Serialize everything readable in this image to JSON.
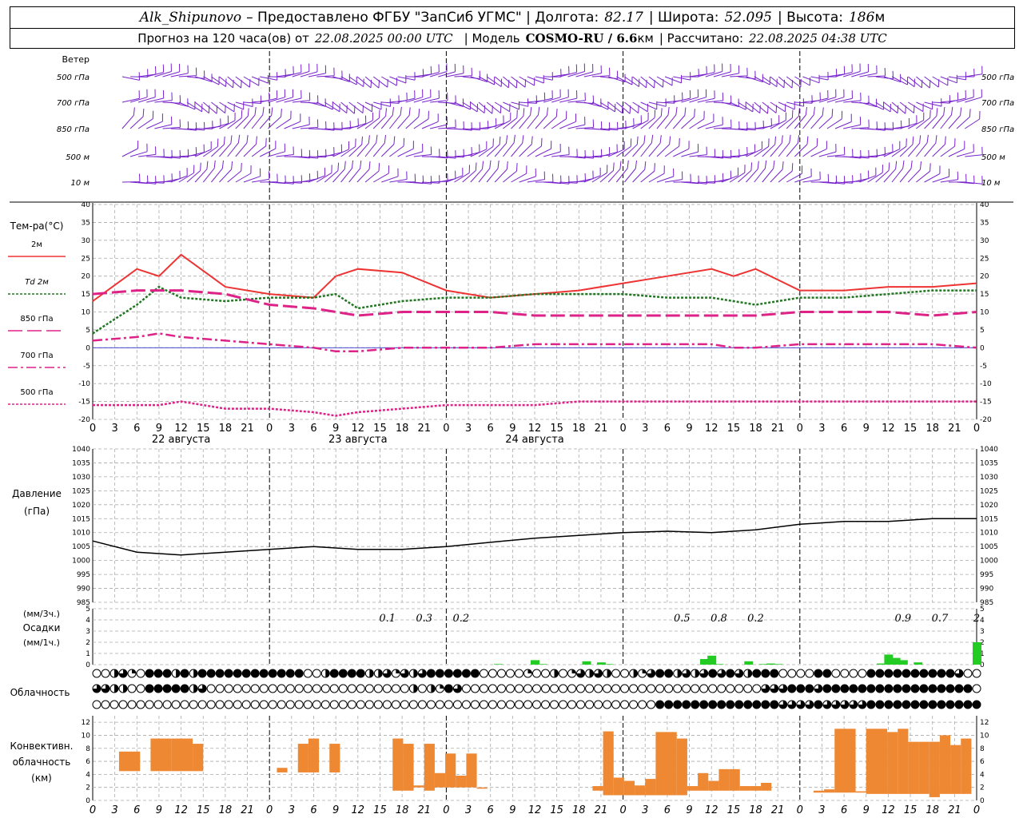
{
  "header": {
    "station": "Alk_Shipunovo",
    "provider": " – Предоставлено ФГБУ \"ЗапСиб УГМС\" | Долгота:",
    "lon": "82.17",
    "lat_label": "| Широта:",
    "lat": "52.095",
    "alt_label": "| Высота:",
    "alt": "186",
    "alt_unit": "м",
    "fc_label": "Прогноз на 120 часа(ов) от",
    "fc_start": "22.08.2025 00:00 UTC",
    "model_label": "| Модель",
    "model": "COSMO-RU / 6.6",
    "model_unit": "км",
    "calc_label": "| Рассчитано:",
    "calc_time": "22.08.2025 04:38 UTC"
  },
  "chart_data": [
    {
      "type": "wind_barbs",
      "title": "Ветер",
      "levels": [
        "500 гПа",
        "700 гПа",
        "850 гПа",
        "500 м",
        "10 м"
      ]
    },
    {
      "type": "line",
      "ylabel": "Тем-ра(°C)",
      "ylim": [
        -20,
        40
      ],
      "yticks": [
        -20,
        -15,
        -10,
        -5,
        0,
        5,
        10,
        15,
        20,
        25,
        30,
        35,
        40
      ],
      "x_hours": [
        0,
        6,
        9,
        12,
        18,
        24,
        30,
        33,
        36,
        42,
        48,
        54,
        60,
        66,
        72,
        78,
        84,
        87,
        90,
        96,
        102,
        108,
        114,
        120
      ],
      "series": [
        {
          "name": "2м",
          "color": "#ee3333",
          "values": [
            13,
            22,
            20,
            26,
            17,
            15,
            14,
            20,
            22,
            21,
            16,
            14,
            15,
            16,
            18,
            20,
            22,
            20,
            22,
            16,
            16,
            17,
            17,
            18
          ]
        },
        {
          "name": "Td 2м",
          "color": "#227722",
          "values": [
            4,
            12,
            17,
            14,
            13,
            14,
            14,
            15,
            11,
            13,
            14,
            14,
            15,
            15,
            15,
            14,
            14,
            13,
            12,
            14,
            14,
            15,
            16,
            16
          ]
        },
        {
          "name": "850 гПа",
          "color": "#dd2288",
          "values": [
            15,
            16,
            16,
            16,
            15,
            12,
            11,
            10,
            9,
            10,
            10,
            10,
            9,
            9,
            9,
            9,
            9,
            9,
            9,
            10,
            10,
            10,
            9,
            10
          ]
        },
        {
          "name": "700 гПа",
          "color": "#dd2288",
          "values": [
            2,
            3,
            4,
            3,
            2,
            1,
            0,
            -1,
            -1,
            0,
            0,
            0,
            1,
            1,
            1,
            1,
            1,
            0,
            0,
            1,
            1,
            1,
            1,
            0
          ]
        },
        {
          "name": "500 гПа",
          "color": "#dd2288",
          "values": [
            -16,
            -16,
            -16,
            -15,
            -17,
            -17,
            -18,
            -19,
            -18,
            -17,
            -16,
            -16,
            -16,
            -15,
            -15,
            -15,
            -15,
            -15,
            -15,
            -15,
            -15,
            -15,
            -15,
            -15
          ]
        }
      ],
      "date_labels": [
        "22 августа",
        "23 августа",
        "24 августа"
      ],
      "xtick_labels": [
        "0",
        "3",
        "6",
        "9",
        "12",
        "15",
        "18",
        "21",
        "0",
        "3",
        "6",
        "9",
        "12",
        "15",
        "18",
        "21",
        "0",
        "3",
        "6",
        "9",
        "12",
        "15",
        "18",
        "21",
        "0",
        "3",
        "6"
      ]
    },
    {
      "type": "line",
      "ylabel": "Давление",
      "yunit": "(гПа)",
      "ylim": [
        985,
        1040
      ],
      "yticks": [
        985,
        990,
        995,
        1000,
        1005,
        1010,
        1015,
        1020,
        1025,
        1030,
        1035,
        1040
      ],
      "x_hours": [
        0,
        6,
        12,
        18,
        24,
        30,
        36,
        42,
        48,
        54,
        60,
        66,
        72,
        78,
        84,
        90,
        96,
        102,
        108,
        114,
        120
      ],
      "series": [
        {
          "name": "pressure",
          "color": "#000000",
          "values": [
            1007,
            1003,
            1002,
            1003,
            1004,
            1005,
            1004,
            1004,
            1005,
            1006.5,
            1008,
            1009,
            1010,
            1010.5,
            1010,
            1011,
            1013,
            1014,
            1014,
            1015,
            1015
          ]
        }
      ]
    },
    {
      "type": "bar",
      "ylabel_top": "(мм/3ч.)",
      "ylabel": "Осадки",
      "ylabel_bottom": "(мм/1ч.)",
      "ylim": [
        0,
        5
      ],
      "yticks": [
        0,
        1,
        2,
        3,
        4,
        5
      ],
      "color": "#22cc22",
      "x_hours": [
        55,
        60,
        61,
        67,
        69,
        70,
        83,
        84,
        85,
        89,
        91,
        92,
        93,
        107,
        108,
        109,
        110,
        112,
        120
      ],
      "values": [
        0.05,
        0.4,
        0.05,
        0.3,
        0.2,
        0.05,
        0.5,
        0.8,
        0.05,
        0.3,
        0.05,
        0.1,
        0.05,
        0.1,
        0.9,
        0.6,
        0.4,
        0.2,
        2
      ],
      "totals": [
        {
          "hour": 48,
          "label": "0.1"
        },
        {
          "hour": 54,
          "label": "0.3"
        },
        {
          "hour": 60,
          "label": "0.2"
        },
        {
          "hour": 96,
          "label": "0.5"
        },
        {
          "hour": 102,
          "label": "0.8"
        },
        {
          "hour": 108,
          "label": "0.2"
        },
        {
          "hour": 132,
          "label": "0.9"
        },
        {
          "hour": 138,
          "label": "0.7"
        },
        {
          "hour": 144,
          "label": "2"
        }
      ]
    },
    {
      "type": "cloud_cover",
      "title": "Облачность",
      "rows": [
        [
          0,
          0,
          2,
          3,
          1,
          0,
          4,
          4,
          4,
          2,
          4,
          2,
          4,
          4,
          4,
          4,
          4,
          4,
          4,
          4,
          4,
          4,
          4,
          4,
          0,
          0,
          2,
          4,
          4,
          4,
          4,
          2,
          2,
          3,
          1,
          3,
          2,
          3,
          4,
          4,
          4,
          4,
          4,
          4,
          0,
          0,
          0,
          0,
          0,
          1,
          0,
          0,
          2,
          0,
          1,
          3,
          2,
          3,
          2,
          0,
          0,
          2,
          1,
          3,
          4,
          4,
          2,
          3,
          2,
          3,
          4,
          3,
          4,
          3,
          2,
          4,
          4,
          4,
          0,
          0,
          0,
          0,
          4,
          4,
          0,
          0,
          0,
          0,
          4,
          4,
          4,
          4,
          4,
          4,
          4,
          4,
          4,
          4,
          3,
          0,
          0
        ],
        [
          3,
          3,
          2,
          2,
          0,
          0,
          4,
          4,
          4,
          4,
          4,
          2,
          3,
          0,
          0,
          0,
          0,
          0,
          0,
          0,
          0,
          0,
          0,
          0,
          0,
          0,
          0,
          0,
          0,
          0,
          0,
          0,
          0,
          0,
          0,
          0,
          2,
          0,
          2,
          1,
          4,
          3,
          0,
          0,
          0,
          0,
          0,
          0,
          0,
          0,
          0,
          0,
          0,
          0,
          0,
          0,
          0,
          0,
          0,
          0,
          0,
          0,
          0,
          0,
          0,
          0,
          0,
          0,
          0,
          0,
          0,
          0,
          0,
          0,
          0,
          0,
          3,
          3,
          3,
          4,
          4,
          4,
          3,
          4,
          4,
          4,
          4,
          4,
          4,
          4,
          4,
          4,
          4,
          4,
          4,
          4,
          4,
          4,
          4,
          4,
          0
        ],
        [
          0,
          0,
          0,
          0,
          0,
          0,
          0,
          0,
          0,
          0,
          0,
          0,
          0,
          0,
          0,
          0,
          0,
          0,
          0,
          0,
          0,
          0,
          0,
          0,
          0,
          0,
          0,
          0,
          0,
          0,
          0,
          0,
          0,
          0,
          0,
          0,
          0,
          0,
          0,
          0,
          0,
          0,
          0,
          0,
          0,
          0,
          0,
          0,
          0,
          0,
          0,
          0,
          0,
          0,
          0,
          0,
          0,
          0,
          0,
          0,
          0,
          0,
          0,
          0,
          4,
          4,
          4,
          4,
          4,
          4,
          4,
          4,
          4,
          4,
          4,
          4,
          4,
          4,
          3,
          3,
          3,
          3,
          4,
          3,
          3,
          3,
          3,
          3,
          4,
          4,
          4,
          4,
          4,
          4,
          4,
          4,
          4,
          4,
          4,
          4,
          4
        ]
      ]
    },
    {
      "type": "range_bar",
      "ylabel": "Конвективн.",
      "ylabel2": "облачность",
      "ylabel3": "(км)",
      "ylim": [
        0,
        13
      ],
      "yticks": [
        0,
        2,
        4,
        6,
        8,
        10,
        12
      ],
      "color": "#ee8833",
      "bars": [
        {
          "x0": 2.5,
          "x1": 4.5,
          "base": 4.5,
          "top": 7.5
        },
        {
          "x0": 5.5,
          "x1": 7.5,
          "base": 4.5,
          "top": 9.5
        },
        {
          "x0": 7.5,
          "x1": 9.5,
          "base": 4.5,
          "top": 9.5
        },
        {
          "x0": 9.5,
          "x1": 10.5,
          "base": 4.5,
          "top": 8.7
        },
        {
          "x0": 17.5,
          "x1": 18.5,
          "base": 4.3,
          "top": 5
        },
        {
          "x0": 19.5,
          "x1": 20.5,
          "base": 4.3,
          "top": 8.7
        },
        {
          "x0": 20.5,
          "x1": 21.5,
          "base": 4.3,
          "top": 9.5
        },
        {
          "x0": 22.5,
          "x1": 23.5,
          "base": 4.3,
          "top": 8.7
        },
        {
          "x0": 28.5,
          "x1": 29.5,
          "base": 1.5,
          "top": 9.5
        },
        {
          "x0": 29.5,
          "x1": 30.5,
          "base": 1.5,
          "top": 8.7
        },
        {
          "x0": 30.5,
          "x1": 31.5,
          "base": 2,
          "top": 2.3
        },
        {
          "x0": 31.5,
          "x1": 32.5,
          "base": 1.5,
          "top": 8.7
        },
        {
          "x0": 32.5,
          "x1": 33.5,
          "base": 2,
          "top": 4.2
        },
        {
          "x0": 33.5,
          "x1": 34.5,
          "base": 2,
          "top": 7.2
        },
        {
          "x0": 34.5,
          "x1": 35.5,
          "base": 2,
          "top": 3.8
        },
        {
          "x0": 35.5,
          "x1": 36.5,
          "base": 2,
          "top": 7.2
        },
        {
          "x0": 36.5,
          "x1": 37.5,
          "base": 1.8,
          "top": 2
        },
        {
          "x0": 47.5,
          "x1": 48.5,
          "base": 1.5,
          "top": 2.2
        },
        {
          "x0": 48.5,
          "x1": 49.5,
          "base": 0.8,
          "top": 10.6
        },
        {
          "x0": 49.5,
          "x1": 50.5,
          "base": 0.8,
          "top": 3.5
        },
        {
          "x0": 50.5,
          "x1": 51.5,
          "base": 0.8,
          "top": 3
        },
        {
          "x0": 51.5,
          "x1": 52.5,
          "base": 0.8,
          "top": 2.3
        },
        {
          "x0": 52.5,
          "x1": 53.5,
          "base": 0.8,
          "top": 3.3
        },
        {
          "x0": 53.5,
          "x1": 55.5,
          "base": 0.8,
          "top": 10.5
        },
        {
          "x0": 55.5,
          "x1": 56.5,
          "base": 0.8,
          "top": 9.5
        },
        {
          "x0": 56.5,
          "x1": 57.5,
          "base": 1.5,
          "top": 2.2
        },
        {
          "x0": 57.5,
          "x1": 58.5,
          "base": 1.5,
          "top": 4.2
        },
        {
          "x0": 58.5,
          "x1": 59.5,
          "base": 1.5,
          "top": 3
        },
        {
          "x0": 59.5,
          "x1": 60.5,
          "base": 1.5,
          "top": 4.8
        },
        {
          "x0": 60.5,
          "x1": 61.5,
          "base": 1.5,
          "top": 4.8
        },
        {
          "x0": 61.5,
          "x1": 62.5,
          "base": 1.5,
          "top": 2.2
        },
        {
          "x0": 62.5,
          "x1": 63.5,
          "base": 1.5,
          "top": 2.2
        },
        {
          "x0": 63.5,
          "x1": 64.5,
          "base": 1.5,
          "top": 2.7
        },
        {
          "x0": 68.5,
          "x1": 69.5,
          "base": 1.2,
          "top": 1.5
        },
        {
          "x0": 69.5,
          "x1": 70.5,
          "base": 1.2,
          "top": 1.7
        },
        {
          "x0": 70.5,
          "x1": 72.5,
          "base": 1.2,
          "top": 11
        },
        {
          "x0": 72.5,
          "x1": 73.5,
          "base": 1.2,
          "top": 1.4
        },
        {
          "x0": 73.5,
          "x1": 75.5,
          "base": 1,
          "top": 11
        },
        {
          "x0": 75.5,
          "x1": 76.5,
          "base": 1,
          "top": 10.5
        },
        {
          "x0": 76.5,
          "x1": 77.5,
          "base": 1,
          "top": 11
        },
        {
          "x0": 77.5,
          "x1": 78.5,
          "base": 1,
          "top": 9
        },
        {
          "x0": 78.5,
          "x1": 79.5,
          "base": 1,
          "top": 9
        },
        {
          "x0": 79.5,
          "x1": 80.5,
          "base": 0.5,
          "top": 9
        },
        {
          "x0": 80.5,
          "x1": 81.5,
          "base": 1,
          "top": 10
        },
        {
          "x0": 81.5,
          "x1": 82.5,
          "base": 1,
          "top": 8.5
        },
        {
          "x0": 82.5,
          "x1": 83.5,
          "base": 1,
          "top": 9.5
        }
      ]
    }
  ]
}
